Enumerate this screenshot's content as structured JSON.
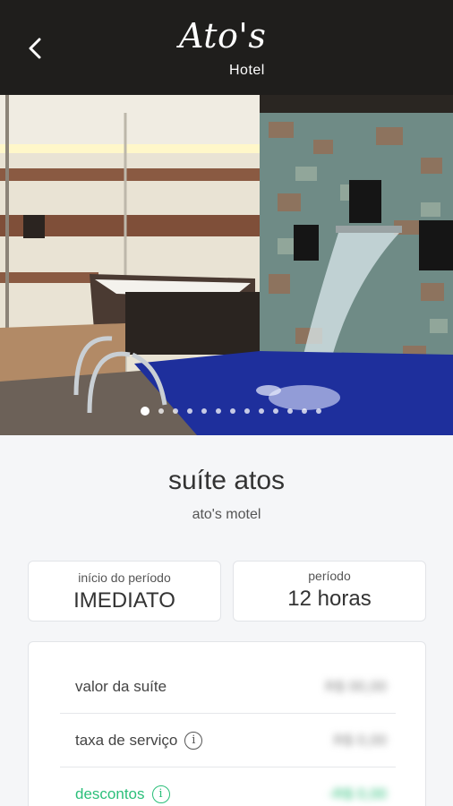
{
  "header": {
    "back_icon": "chevron-left-icon",
    "logo_script": "Ato's",
    "logo_sub": "Hotel",
    "background": "#1f1e1c"
  },
  "gallery": {
    "image": "suite-jacuzzi-waterfall-photo",
    "dot_count": 13,
    "active_index": 0
  },
  "suite": {
    "name": "suíte atos",
    "hotel": "ato's motel"
  },
  "period": {
    "start_label": "início do período",
    "start_value": "IMEDIATO",
    "duration_label": "período",
    "duration_value": "12 horas"
  },
  "pricing": {
    "suite_label": "valor da suíte",
    "suite_value": "R$ 00,00",
    "service_label": "taxa de serviço",
    "service_value": "R$ 0,00",
    "discount_label": "descontos",
    "discount_value": "-R$ 0,00",
    "accent": "#2bbf7a"
  }
}
